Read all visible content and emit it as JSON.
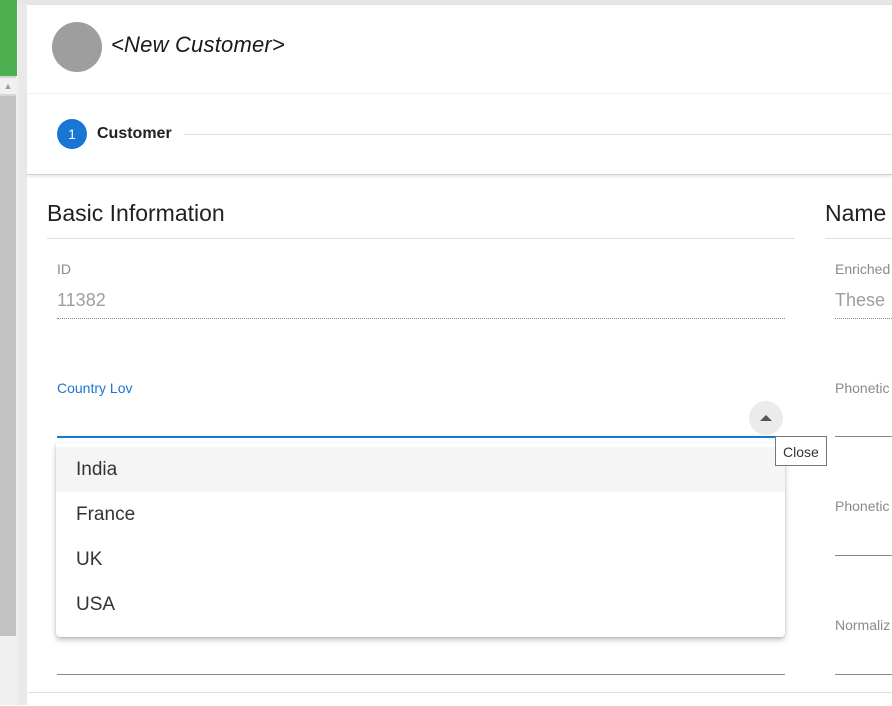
{
  "header": {
    "title": "<New Customer>"
  },
  "stepper": {
    "step_number": "1",
    "step_label": "Customer"
  },
  "basic_info": {
    "title": "Basic Information",
    "id_label": "ID",
    "id_value": "11382",
    "country_label": "Country Lov",
    "toggle_tooltip": "Close",
    "country_options": [
      "India",
      "France",
      "UK",
      "USA"
    ]
  },
  "name_section": {
    "title": "Name",
    "enriched_label": "Enriched",
    "enriched_value": "These",
    "phonetic1_label": "Phonetic",
    "phonetic2_label": "Phonetic",
    "normalized_label": "Normaliz"
  },
  "colors": {
    "accent": "#1976d2",
    "avatar": "#9e9e9e",
    "left_app_green": "#4caf50"
  }
}
